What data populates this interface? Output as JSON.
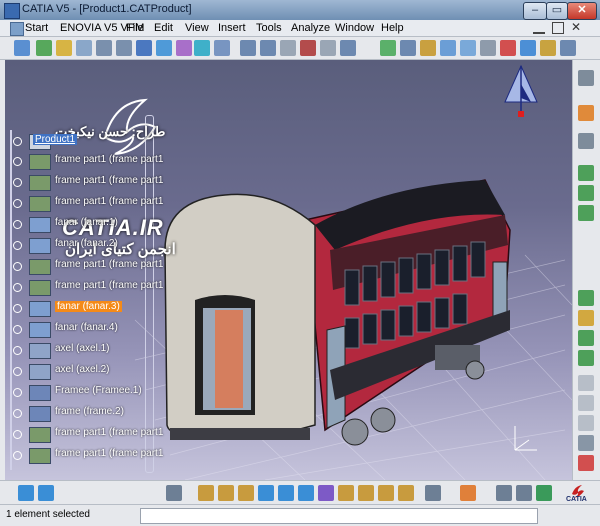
{
  "window": {
    "title": "CATIA V5 - [Product1.CATProduct]"
  },
  "menu": [
    "Start",
    "ENOVIA V5 VPM",
    "File",
    "Edit",
    "View",
    "Insert",
    "Tools",
    "Analyze",
    "Window",
    "Help"
  ],
  "overlay": {
    "author": "طراح: حسن نيکبخت",
    "watermark": "CATIA.IR",
    "watermark_sub": "انجمن کتیای ایران"
  },
  "tree": [
    {
      "label": "Product1",
      "state": "root"
    },
    {
      "label": "frame part1 (frame part1",
      "state": ""
    },
    {
      "label": "frame part1 (frame part1",
      "state": ""
    },
    {
      "label": "frame part1 (frame part1",
      "state": ""
    },
    {
      "label": "fanar (fanar.1)",
      "state": ""
    },
    {
      "label": "fanar (fanar.2)",
      "state": ""
    },
    {
      "label": "frame part1 (frame part1",
      "state": ""
    },
    {
      "label": "frame part1 (frame part1",
      "state": ""
    },
    {
      "label": "fanar (fanar.3)",
      "state": "selected"
    },
    {
      "label": "fanar (fanar.4)",
      "state": ""
    },
    {
      "label": "axel (axel.1)",
      "state": ""
    },
    {
      "label": "axel (axel.2)",
      "state": ""
    },
    {
      "label": "Framee (Framee.1)",
      "state": ""
    },
    {
      "label": "frame (frame.2)",
      "state": ""
    },
    {
      "label": "frame part1 (frame part1",
      "state": ""
    },
    {
      "label": "frame part1 (frame part1",
      "state": ""
    }
  ],
  "status": {
    "text": "1 element selected"
  },
  "logo": {
    "text": "CATIA"
  },
  "colors": {
    "selected": "#f48a18",
    "root_highlight": "#3f72c4",
    "car_body": "#b3283e"
  }
}
